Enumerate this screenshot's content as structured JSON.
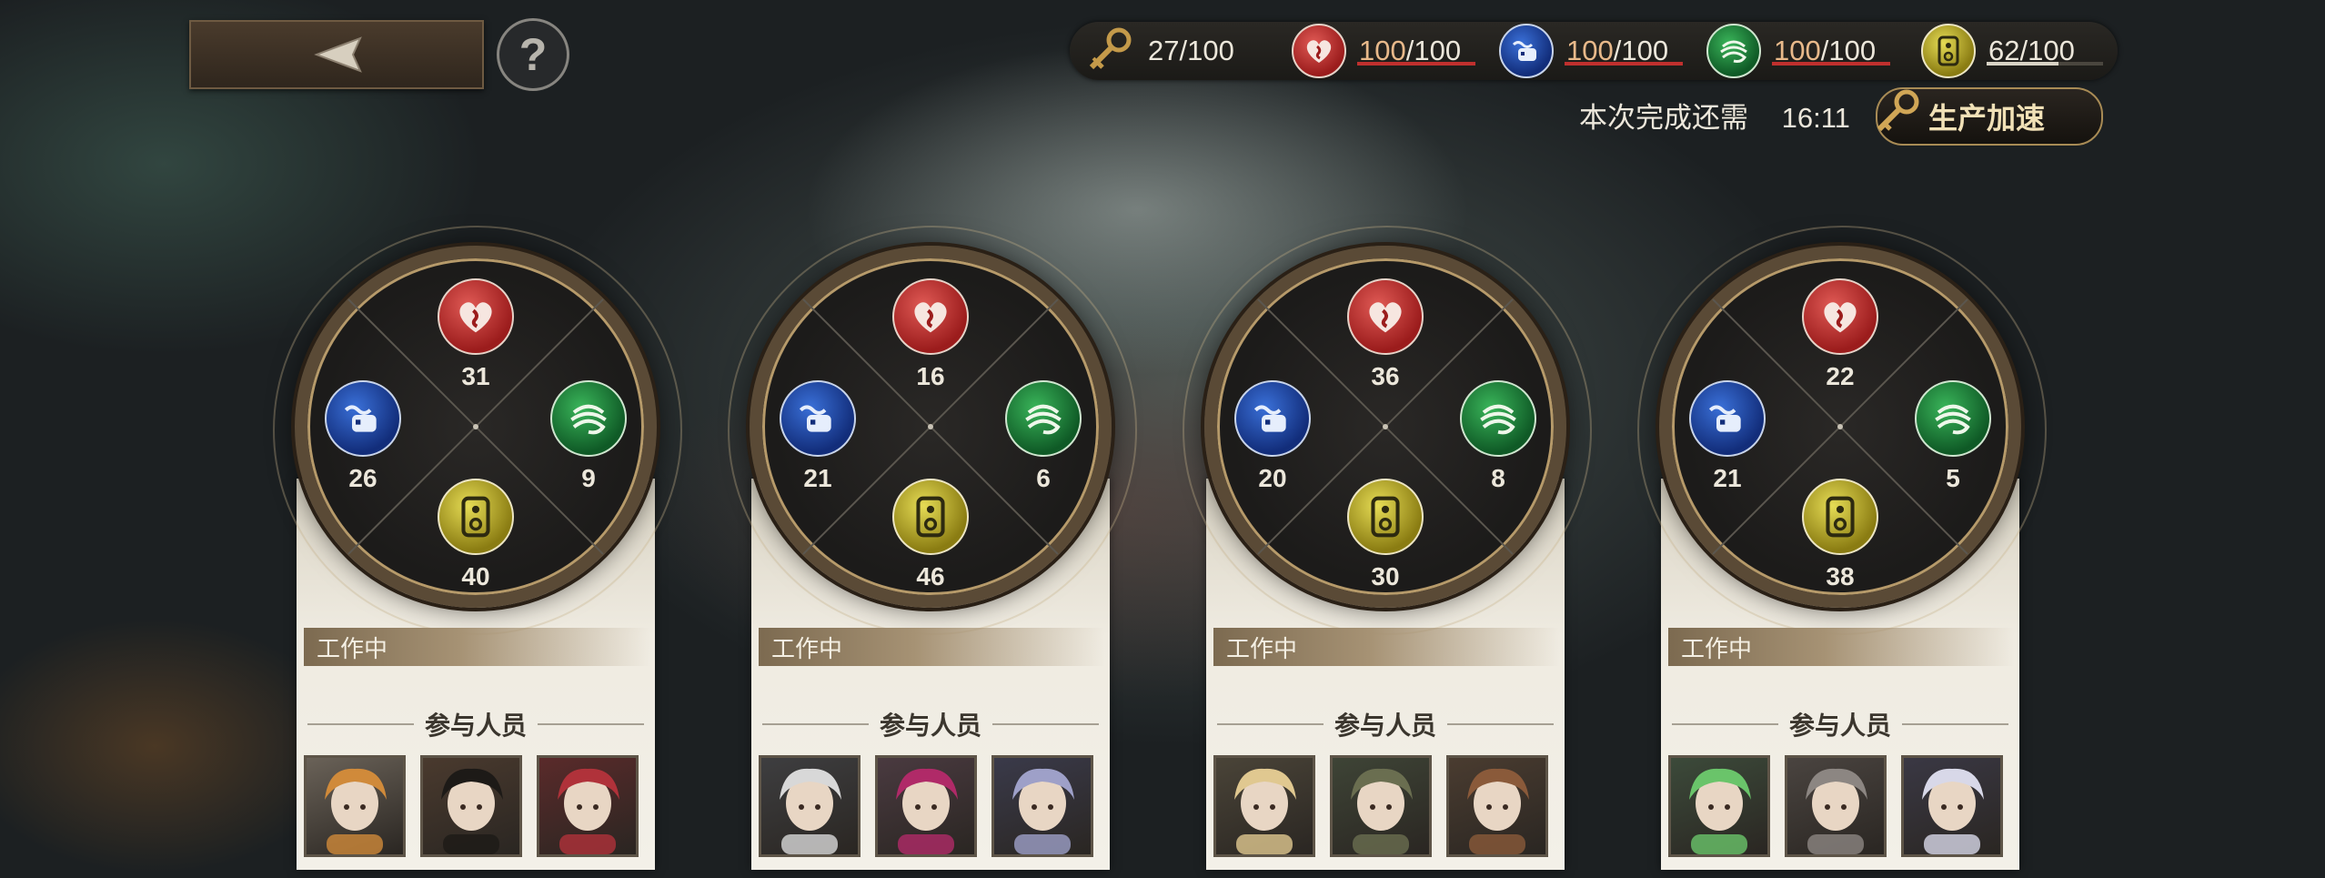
{
  "header": {
    "back_icon": "back-arrow-icon",
    "help_label": "?",
    "resources": [
      {
        "id": "key",
        "icon": "key-icon",
        "text": "27/100",
        "color": "#c49a4a"
      },
      {
        "id": "red",
        "icon": "heart-flame-icon",
        "current": "100",
        "max": "/100",
        "color": "#c0302e",
        "fill": 1.0
      },
      {
        "id": "blue",
        "icon": "fist-wave-icon",
        "current": "100",
        "max": "/100",
        "color": "#c0302e",
        "fill": 1.0
      },
      {
        "id": "green",
        "icon": "swirl-cloud-icon",
        "current": "100",
        "max": "/100",
        "color": "#c0302e",
        "fill": 1.0
      },
      {
        "id": "yellow",
        "icon": "totem-icon",
        "current": "62",
        "max": "/100",
        "color": "#d8d3c5",
        "fill": 0.62
      }
    ],
    "remaining_label": "本次完成还需",
    "remaining_time": "16:11",
    "speed_label": "生产加速"
  },
  "stations": [
    {
      "top": "31",
      "left": "26",
      "right": "9",
      "bottom": "40",
      "status": "工作中",
      "participants_label": "参与人员",
      "portraits": [
        {
          "bg": "#6a6258",
          "accent": "#d08a3a"
        },
        {
          "bg": "#4a3a2e",
          "accent": "#1d1a17"
        },
        {
          "bg": "#5a2a2a",
          "accent": "#b0323a"
        }
      ]
    },
    {
      "top": "16",
      "left": "21",
      "right": "6",
      "bottom": "46",
      "status": "工作中",
      "participants_label": "参与人员",
      "portraits": [
        {
          "bg": "#3e3e40",
          "accent": "#d8d8d8"
        },
        {
          "bg": "#4a3a40",
          "accent": "#b02a68"
        },
        {
          "bg": "#3a3a4a",
          "accent": "#9ea0c8"
        }
      ]
    },
    {
      "top": "36",
      "left": "20",
      "right": "8",
      "bottom": "30",
      "status": "工作中",
      "participants_label": "参与人员",
      "portraits": [
        {
          "bg": "#4a4438",
          "accent": "#e0c890"
        },
        {
          "bg": "#3e4436",
          "accent": "#6a6e50"
        },
        {
          "bg": "#4a3c30",
          "accent": "#8a5a3a"
        }
      ]
    },
    {
      "top": "22",
      "left": "21",
      "right": "5",
      "bottom": "38",
      "status": "工作中",
      "participants_label": "参与人员",
      "portraits": [
        {
          "bg": "#3c4a3a",
          "accent": "#6ac46a"
        },
        {
          "bg": "#4a4440",
          "accent": "#8c8682"
        },
        {
          "bg": "#3a3844",
          "accent": "#d8d8e8"
        }
      ]
    }
  ]
}
